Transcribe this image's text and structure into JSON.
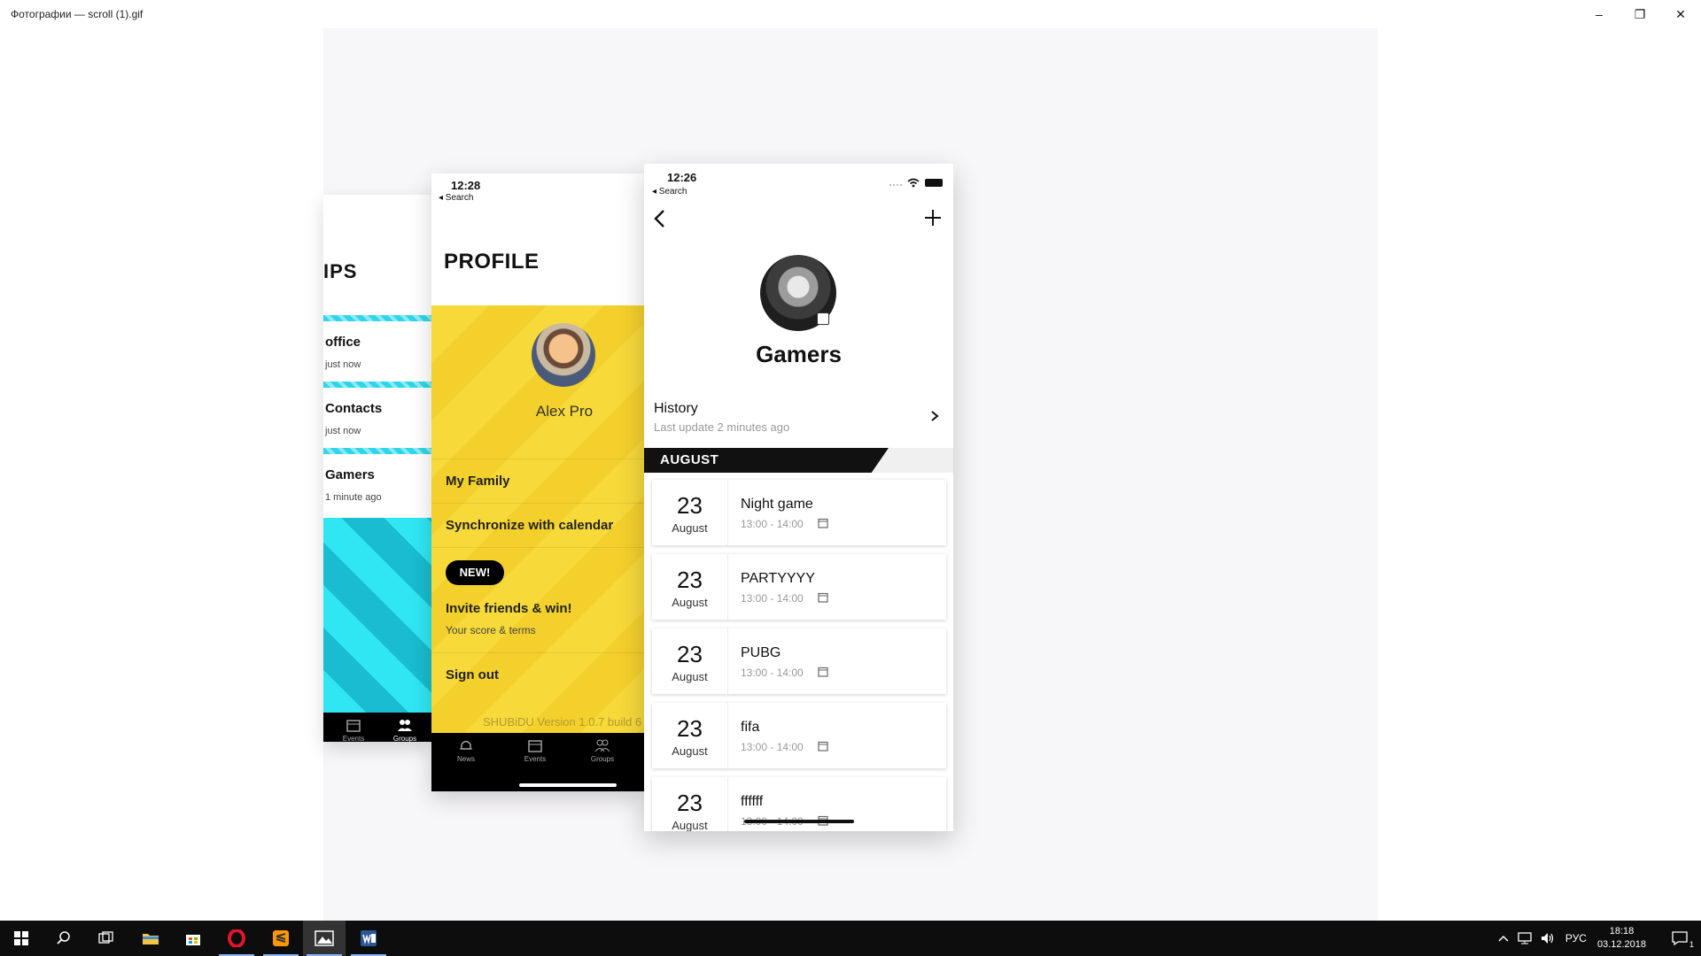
{
  "window": {
    "title": "Фотографии — scroll (1).gif",
    "controls": {
      "minimize": "–",
      "restore": "❐",
      "close": "✕"
    }
  },
  "phone_groups": {
    "title": "IPS",
    "items": [
      {
        "name": "office",
        "time": "just now"
      },
      {
        "name": "Contacts",
        "time": "just now"
      },
      {
        "name": "Gamers",
        "time": "1 minute ago"
      }
    ],
    "tabs": [
      "Events",
      "Groups"
    ],
    "accent": "#2fd6ea"
  },
  "phone_profile": {
    "status_time": "12:28",
    "back_label": "◂ Search",
    "title": "PROFILE",
    "user_name": "Alex Pro",
    "menu": {
      "family": "My Family",
      "sync": "Synchronize with calendar",
      "badge": "NEW!",
      "invite": "Invite friends & win!",
      "invite_sub": "Your score & terms",
      "signout": "Sign out"
    },
    "version": "SHUBiDU Version 1.0.7 build 6",
    "tabs": [
      "News",
      "Events",
      "Groups"
    ],
    "accent": "#f7d93a"
  },
  "phone_gamers": {
    "status_time": "12:26",
    "back_label": "◂ Search",
    "group_name": "Gamers",
    "history_title": "History",
    "history_sub": "Last update 2 minutes ago",
    "month": "AUGUST",
    "events": [
      {
        "day": "23",
        "month": "August",
        "name": "Night game",
        "time": "13:00 - 14:00"
      },
      {
        "day": "23",
        "month": "August",
        "name": "PARTYYYY",
        "time": "13:00 - 14:00"
      },
      {
        "day": "23",
        "month": "August",
        "name": "PUBG",
        "time": "13:00 - 14:00"
      },
      {
        "day": "23",
        "month": "August",
        "name": "fifa",
        "time": "13:00 - 14:00"
      },
      {
        "day": "23",
        "month": "August",
        "name": "ffffff",
        "time": "13:00 - 14:00"
      }
    ]
  },
  "taskbar": {
    "apps": [
      "start-icon",
      "search-icon",
      "task-view-icon",
      "file-explorer-icon",
      "store-icon",
      "opera-icon",
      "sublime-icon",
      "photos-icon",
      "word-icon"
    ],
    "active_app": "photos-icon",
    "language": "РУС",
    "clock_time": "18:18",
    "clock_date": "03.12.2018",
    "notification_count": "1"
  }
}
